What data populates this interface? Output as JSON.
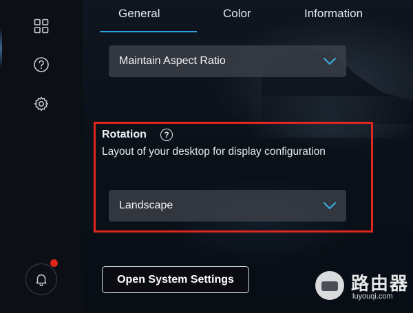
{
  "tabs": [
    {
      "label": "General",
      "active": true
    },
    {
      "label": "Color",
      "active": false
    },
    {
      "label": "Information",
      "active": false
    }
  ],
  "scaling": {
    "value": "Maintain Aspect Ratio"
  },
  "rotation": {
    "title": "Rotation",
    "help_symbol": "?",
    "description": "Layout of your desktop for display configuration",
    "value": "Landscape"
  },
  "actions": {
    "open_system_settings": "Open System Settings"
  },
  "sidebar": {
    "icons": [
      "grid-icon",
      "help-icon",
      "gear-icon",
      "bell-icon"
    ],
    "notification_badge": true
  },
  "colors": {
    "accent": "#2ea3dd",
    "highlight_box": "#e0261d",
    "badge": "#e0261d"
  },
  "watermark": {
    "cn": "路由器",
    "en": "luyouqi.com"
  }
}
